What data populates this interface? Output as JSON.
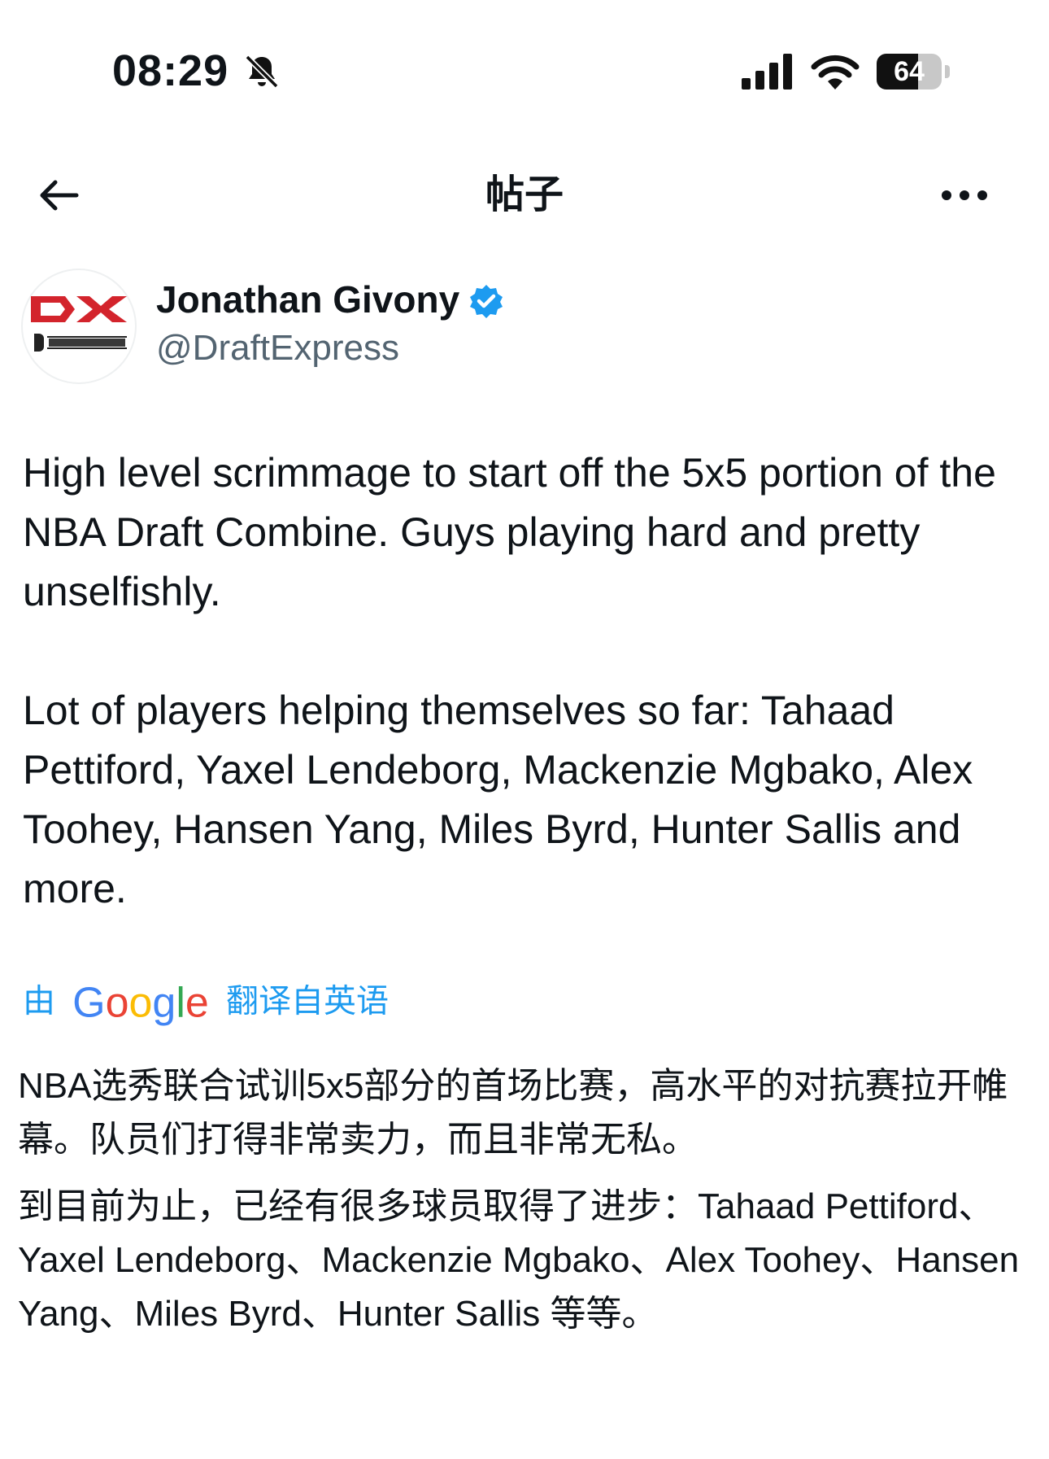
{
  "status_bar": {
    "time": "08:29",
    "battery_level": "64",
    "battery_fraction": 0.64,
    "icons": [
      "bell-muted-icon",
      "cellular-signal-icon",
      "wifi-icon",
      "battery-icon"
    ]
  },
  "nav": {
    "title": "帖子",
    "back_icon": "back-arrow-icon",
    "more_icon": "more-options-icon"
  },
  "author": {
    "name": "Jonathan Givony",
    "handle": "@DraftExpress",
    "verified": true,
    "avatar_brand": "DraftExpress logo",
    "colors": {
      "verified": "#1d9bf0",
      "brand_red": "#d3242c"
    }
  },
  "tweet": {
    "paragraphs": [
      "High level scrimmage to start off the 5x5 portion of the NBA Draft Combine. Guys playing hard and pretty unselfishly.",
      "Lot of players helping themselves so far: Tahaad Pettiford, Yaxel Lendeborg, Mackenzie Mgbako, Alex Toohey, Hansen Yang, Miles Byrd, Hunter Sallis and more."
    ]
  },
  "translation": {
    "prefix": "由",
    "provider": "Google",
    "suffix": "翻译自英语",
    "paragraphs": [
      "NBA选秀联合试训5x5部分的首场比赛，高水平的对抗赛拉开帷幕。队员们打得非常卖力，而且非常无私。",
      "到目前为止，已经有很多球员取得了进步：Tahaad Pettiford、Yaxel Lendeborg、Mackenzie Mgbako、Alex Toohey、Hansen Yang、Miles Byrd、Hunter Sallis 等等。"
    ]
  }
}
